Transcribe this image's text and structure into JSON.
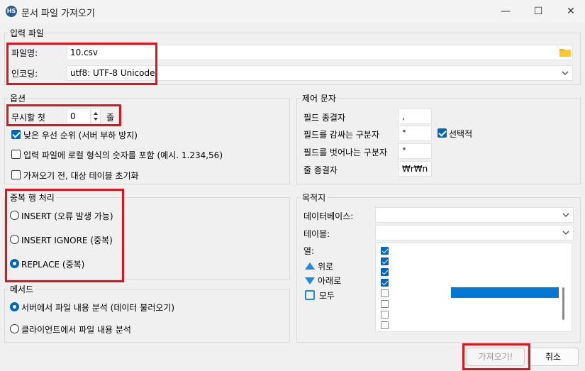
{
  "window": {
    "title": "문서 파일 가져오기",
    "app_icon_text": "HS",
    "minimize": "—",
    "maximize": "☐",
    "close": "✕"
  },
  "input_file": {
    "group_label": "입력 파일",
    "filename_label": "파일명:",
    "filename_value": "10.csv",
    "encoding_label": "인코딩:",
    "encoding_value": "utf8: UTF-8 Unicode"
  },
  "options": {
    "group_label": "옵션",
    "ignore_first_label": "무시할 첫",
    "ignore_first_value": "0",
    "ignore_first_suffix": "줄",
    "low_priority_label": "낮은 우선 순위 (서버 부하 방지)",
    "low_priority_checked": true,
    "local_number_label": "입력 파일에 로컬 형식의 숫자를 포함 (예시. 1.234,56)",
    "local_number_checked": false,
    "truncate_label": "가져오기 전, 대상 테이블 초기화",
    "truncate_checked": false
  },
  "control_chars": {
    "group_label": "제어 문자",
    "field_terminator_label": "필드 종결자",
    "field_terminator_value": ",",
    "field_enclosure_label": "필드를 감싸는 구분자",
    "field_enclosure_value": "\"",
    "optional_label": "선택적",
    "optional_checked": true,
    "field_escape_label": "필드를 벗어나는 구분자",
    "field_escape_value": "\"",
    "line_terminator_label": "줄 종결자",
    "line_terminator_value": "₩r₩n"
  },
  "duplicate": {
    "group_label": "중복 행 처리",
    "options": [
      {
        "label": "INSERT (오류 발생 가능)",
        "selected": false
      },
      {
        "label": "INSERT IGNORE (중복)",
        "selected": false
      },
      {
        "label": "REPLACE (중복)",
        "selected": true
      }
    ]
  },
  "method": {
    "group_label": "메서드",
    "options": [
      {
        "label": "서버에서 파일 내용 분석 (데이터 불러오기)",
        "selected": true
      },
      {
        "label": "클라이언트에서 파일 내용 분석",
        "selected": false
      }
    ]
  },
  "destination": {
    "group_label": "목적지",
    "database_label": "데이터베이스:",
    "database_value": "",
    "table_label": "테이블:",
    "table_value": "",
    "columns_label": "열:",
    "up_label": "위로",
    "down_label": "아래로",
    "all_label": "모두",
    "columns": [
      {
        "checked": true
      },
      {
        "checked": true
      },
      {
        "checked": true
      },
      {
        "checked": true
      },
      {
        "checked": false
      },
      {
        "checked": false
      },
      {
        "checked": false
      },
      {
        "checked": false
      }
    ]
  },
  "buttons": {
    "import_label": "가져오기!",
    "cancel_label": "취소"
  },
  "colors": {
    "accent": "#0067c0",
    "highlight_box": "#e3121b",
    "folder": "#f2b600",
    "arrow": "#1e88e5"
  }
}
